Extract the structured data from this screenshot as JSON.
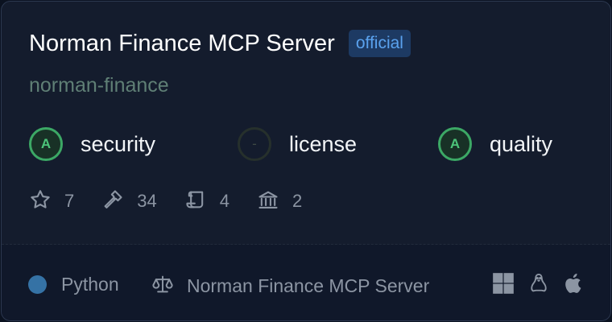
{
  "server": {
    "title": "Norman Finance MCP Server",
    "badge": "official",
    "slug": "norman-finance"
  },
  "scores": [
    {
      "grade": "A",
      "label": "security"
    },
    {
      "grade": "-",
      "label": "license"
    },
    {
      "grade": "A",
      "label": "quality"
    }
  ],
  "stats": {
    "stars": "7",
    "tools": "34",
    "scrolls": "4",
    "institutions": "2"
  },
  "footer": {
    "language": "Python",
    "license_text": "Norman Finance MCP Server",
    "language_color": "#3572a5"
  },
  "platform_icons": [
    "windows-icon",
    "linux-icon",
    "apple-icon"
  ],
  "colors": {
    "badge_bg": "#1d3a63",
    "badge_text": "#5aa2ee",
    "grade_a": "#3ca865",
    "slug": "#5f7f75"
  }
}
